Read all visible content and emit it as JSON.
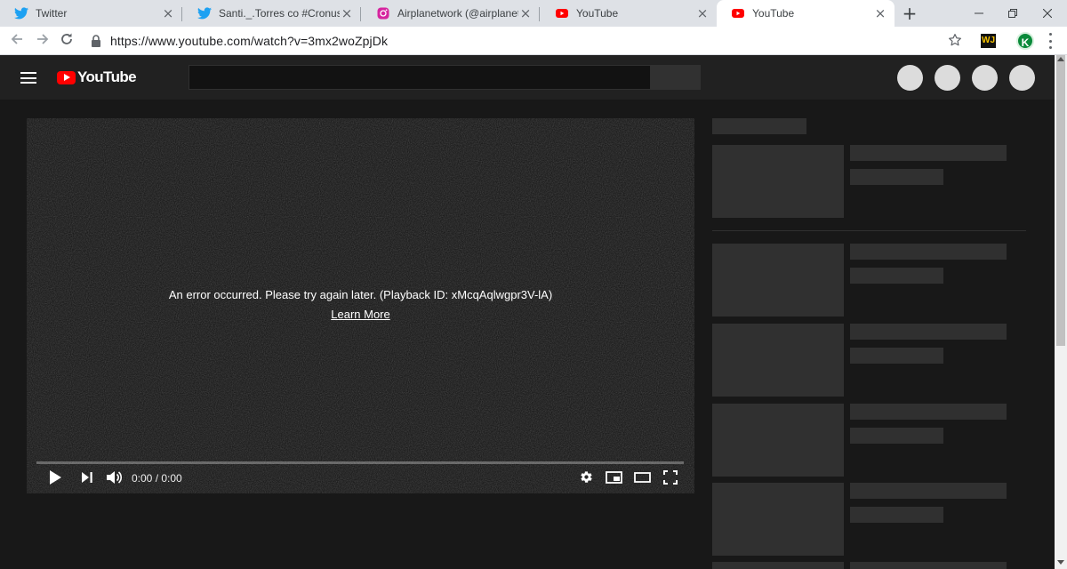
{
  "browser": {
    "tabs": [
      {
        "title": "Twitter",
        "icon": "twitter-icon",
        "active": false
      },
      {
        "title": "Santi._.Torres co #Cronusito❣️",
        "icon": "twitter-icon",
        "active": false
      },
      {
        "title": "Airplanetwork (@airplanetwork)",
        "icon": "instagram-icon",
        "active": false
      },
      {
        "title": "YouTube",
        "icon": "youtube-icon",
        "active": false
      },
      {
        "title": "YouTube",
        "icon": "youtube-icon",
        "active": true
      }
    ],
    "new_tab_symbol": "+",
    "url": "https://www.youtube.com/watch?v=3mx2woZpjDk",
    "extensions": [
      "WJ",
      "K"
    ]
  },
  "youtube": {
    "logo_text": "YouTube",
    "brand_color": "#ff0000"
  },
  "player": {
    "error_message": "An error occurred. Please try again later. (Playback ID: xMcqAqlwgpr3V-lA)",
    "learn_more": "Learn More",
    "time": "0:00 / 0:00",
    "controls": [
      "play-icon",
      "next-icon",
      "volume-icon",
      "settings-icon",
      "miniplayer-icon",
      "theater-icon",
      "fullscreen-icon"
    ]
  },
  "colors": {
    "page_bg": "#181818",
    "masthead_bg": "#212121",
    "skeleton": "#303030"
  }
}
